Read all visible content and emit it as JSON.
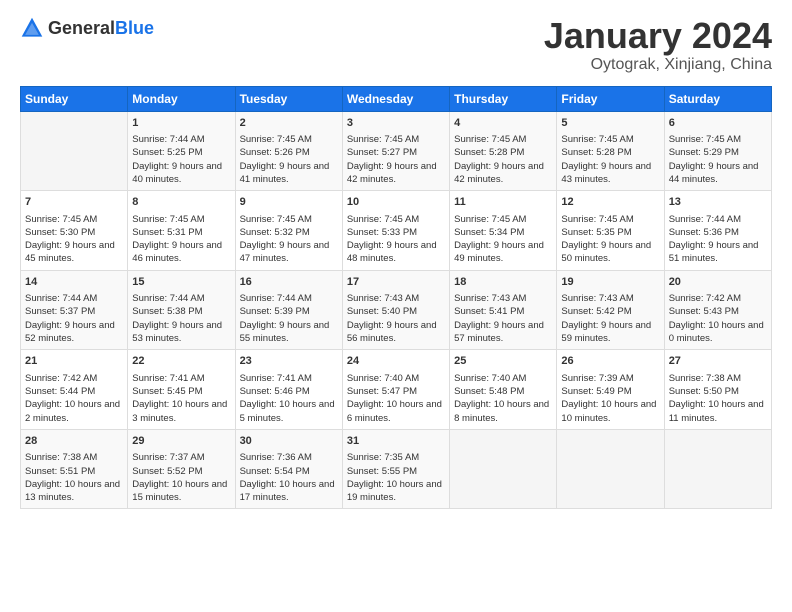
{
  "header": {
    "logo_general": "General",
    "logo_blue": "Blue",
    "month": "January 2024",
    "location": "Oytograk, Xinjiang, China"
  },
  "weekdays": [
    "Sunday",
    "Monday",
    "Tuesday",
    "Wednesday",
    "Thursday",
    "Friday",
    "Saturday"
  ],
  "weeks": [
    [
      {
        "day": "",
        "sunrise": "",
        "sunset": "",
        "daylight": ""
      },
      {
        "day": "1",
        "sunrise": "Sunrise: 7:44 AM",
        "sunset": "Sunset: 5:25 PM",
        "daylight": "Daylight: 9 hours and 40 minutes."
      },
      {
        "day": "2",
        "sunrise": "Sunrise: 7:45 AM",
        "sunset": "Sunset: 5:26 PM",
        "daylight": "Daylight: 9 hours and 41 minutes."
      },
      {
        "day": "3",
        "sunrise": "Sunrise: 7:45 AM",
        "sunset": "Sunset: 5:27 PM",
        "daylight": "Daylight: 9 hours and 42 minutes."
      },
      {
        "day": "4",
        "sunrise": "Sunrise: 7:45 AM",
        "sunset": "Sunset: 5:28 PM",
        "daylight": "Daylight: 9 hours and 42 minutes."
      },
      {
        "day": "5",
        "sunrise": "Sunrise: 7:45 AM",
        "sunset": "Sunset: 5:28 PM",
        "daylight": "Daylight: 9 hours and 43 minutes."
      },
      {
        "day": "6",
        "sunrise": "Sunrise: 7:45 AM",
        "sunset": "Sunset: 5:29 PM",
        "daylight": "Daylight: 9 hours and 44 minutes."
      }
    ],
    [
      {
        "day": "7",
        "sunrise": "Sunrise: 7:45 AM",
        "sunset": "Sunset: 5:30 PM",
        "daylight": "Daylight: 9 hours and 45 minutes."
      },
      {
        "day": "8",
        "sunrise": "Sunrise: 7:45 AM",
        "sunset": "Sunset: 5:31 PM",
        "daylight": "Daylight: 9 hours and 46 minutes."
      },
      {
        "day": "9",
        "sunrise": "Sunrise: 7:45 AM",
        "sunset": "Sunset: 5:32 PM",
        "daylight": "Daylight: 9 hours and 47 minutes."
      },
      {
        "day": "10",
        "sunrise": "Sunrise: 7:45 AM",
        "sunset": "Sunset: 5:33 PM",
        "daylight": "Daylight: 9 hours and 48 minutes."
      },
      {
        "day": "11",
        "sunrise": "Sunrise: 7:45 AM",
        "sunset": "Sunset: 5:34 PM",
        "daylight": "Daylight: 9 hours and 49 minutes."
      },
      {
        "day": "12",
        "sunrise": "Sunrise: 7:45 AM",
        "sunset": "Sunset: 5:35 PM",
        "daylight": "Daylight: 9 hours and 50 minutes."
      },
      {
        "day": "13",
        "sunrise": "Sunrise: 7:44 AM",
        "sunset": "Sunset: 5:36 PM",
        "daylight": "Daylight: 9 hours and 51 minutes."
      }
    ],
    [
      {
        "day": "14",
        "sunrise": "Sunrise: 7:44 AM",
        "sunset": "Sunset: 5:37 PM",
        "daylight": "Daylight: 9 hours and 52 minutes."
      },
      {
        "day": "15",
        "sunrise": "Sunrise: 7:44 AM",
        "sunset": "Sunset: 5:38 PM",
        "daylight": "Daylight: 9 hours and 53 minutes."
      },
      {
        "day": "16",
        "sunrise": "Sunrise: 7:44 AM",
        "sunset": "Sunset: 5:39 PM",
        "daylight": "Daylight: 9 hours and 55 minutes."
      },
      {
        "day": "17",
        "sunrise": "Sunrise: 7:43 AM",
        "sunset": "Sunset: 5:40 PM",
        "daylight": "Daylight: 9 hours and 56 minutes."
      },
      {
        "day": "18",
        "sunrise": "Sunrise: 7:43 AM",
        "sunset": "Sunset: 5:41 PM",
        "daylight": "Daylight: 9 hours and 57 minutes."
      },
      {
        "day": "19",
        "sunrise": "Sunrise: 7:43 AM",
        "sunset": "Sunset: 5:42 PM",
        "daylight": "Daylight: 9 hours and 59 minutes."
      },
      {
        "day": "20",
        "sunrise": "Sunrise: 7:42 AM",
        "sunset": "Sunset: 5:43 PM",
        "daylight": "Daylight: 10 hours and 0 minutes."
      }
    ],
    [
      {
        "day": "21",
        "sunrise": "Sunrise: 7:42 AM",
        "sunset": "Sunset: 5:44 PM",
        "daylight": "Daylight: 10 hours and 2 minutes."
      },
      {
        "day": "22",
        "sunrise": "Sunrise: 7:41 AM",
        "sunset": "Sunset: 5:45 PM",
        "daylight": "Daylight: 10 hours and 3 minutes."
      },
      {
        "day": "23",
        "sunrise": "Sunrise: 7:41 AM",
        "sunset": "Sunset: 5:46 PM",
        "daylight": "Daylight: 10 hours and 5 minutes."
      },
      {
        "day": "24",
        "sunrise": "Sunrise: 7:40 AM",
        "sunset": "Sunset: 5:47 PM",
        "daylight": "Daylight: 10 hours and 6 minutes."
      },
      {
        "day": "25",
        "sunrise": "Sunrise: 7:40 AM",
        "sunset": "Sunset: 5:48 PM",
        "daylight": "Daylight: 10 hours and 8 minutes."
      },
      {
        "day": "26",
        "sunrise": "Sunrise: 7:39 AM",
        "sunset": "Sunset: 5:49 PM",
        "daylight": "Daylight: 10 hours and 10 minutes."
      },
      {
        "day": "27",
        "sunrise": "Sunrise: 7:38 AM",
        "sunset": "Sunset: 5:50 PM",
        "daylight": "Daylight: 10 hours and 11 minutes."
      }
    ],
    [
      {
        "day": "28",
        "sunrise": "Sunrise: 7:38 AM",
        "sunset": "Sunset: 5:51 PM",
        "daylight": "Daylight: 10 hours and 13 minutes."
      },
      {
        "day": "29",
        "sunrise": "Sunrise: 7:37 AM",
        "sunset": "Sunset: 5:52 PM",
        "daylight": "Daylight: 10 hours and 15 minutes."
      },
      {
        "day": "30",
        "sunrise": "Sunrise: 7:36 AM",
        "sunset": "Sunset: 5:54 PM",
        "daylight": "Daylight: 10 hours and 17 minutes."
      },
      {
        "day": "31",
        "sunrise": "Sunrise: 7:35 AM",
        "sunset": "Sunset: 5:55 PM",
        "daylight": "Daylight: 10 hours and 19 minutes."
      },
      {
        "day": "",
        "sunrise": "",
        "sunset": "",
        "daylight": ""
      },
      {
        "day": "",
        "sunrise": "",
        "sunset": "",
        "daylight": ""
      },
      {
        "day": "",
        "sunrise": "",
        "sunset": "",
        "daylight": ""
      }
    ]
  ]
}
